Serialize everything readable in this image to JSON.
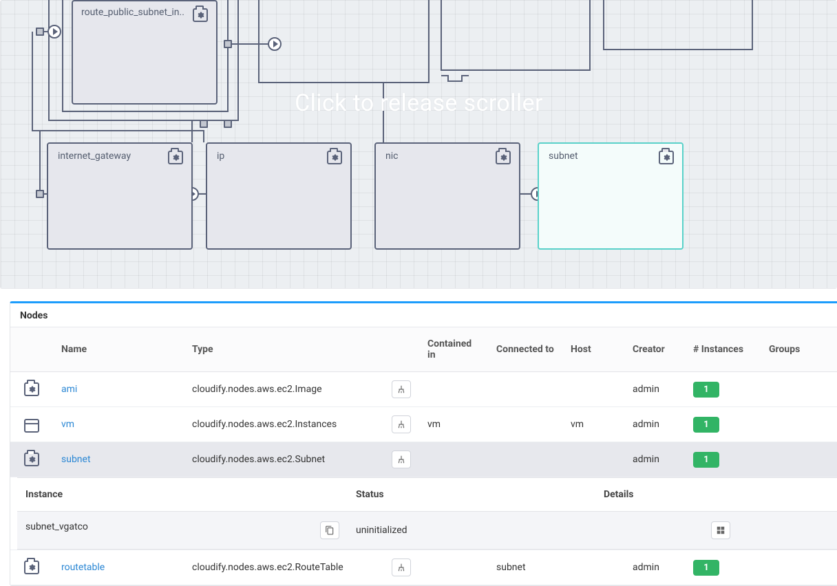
{
  "canvas": {
    "overlay_text": "Click to release scroller",
    "nodes": {
      "route_public_subnet": "route_public_subnet_in..",
      "internet_gateway": "internet_gateway",
      "ip": "ip",
      "nic": "nic",
      "subnet": "subnet"
    }
  },
  "nodes_panel": {
    "title": "Nodes",
    "columns": {
      "name": "Name",
      "type": "Type",
      "contained_in": "Contained in",
      "connected_to": "Connected to",
      "host": "Host",
      "creator": "Creator",
      "instances": "# Instances",
      "groups": "Groups"
    },
    "rows": [
      {
        "icon_style": "gear",
        "name": "ami",
        "type": "cloudify.nodes.aws.ec2.Image",
        "contained_in": "",
        "connected_to": "",
        "host": "",
        "creator": "admin",
        "instances": "1",
        "groups": "",
        "selected": false
      },
      {
        "icon_style": "list",
        "name": "vm",
        "type": "cloudify.nodes.aws.ec2.Instances",
        "contained_in": "vm",
        "connected_to": "",
        "host": "vm",
        "creator": "admin",
        "instances": "1",
        "groups": "",
        "selected": false
      },
      {
        "icon_style": "gear",
        "name": "subnet",
        "type": "cloudify.nodes.aws.ec2.Subnet",
        "contained_in": "",
        "connected_to": "",
        "host": "",
        "creator": "admin",
        "instances": "1",
        "groups": "",
        "selected": true
      },
      {
        "icon_style": "gear",
        "name": "routetable",
        "type": "cloudify.nodes.aws.ec2.RouteTable",
        "contained_in": "",
        "connected_to": "subnet",
        "host": "",
        "creator": "admin",
        "instances": "1",
        "groups": "",
        "selected": false
      }
    ],
    "instance_panel": {
      "columns": {
        "instance": "Instance",
        "status": "Status",
        "details": "Details"
      },
      "row": {
        "instance": "subnet_vgatco",
        "status": "uninitialized"
      }
    }
  }
}
